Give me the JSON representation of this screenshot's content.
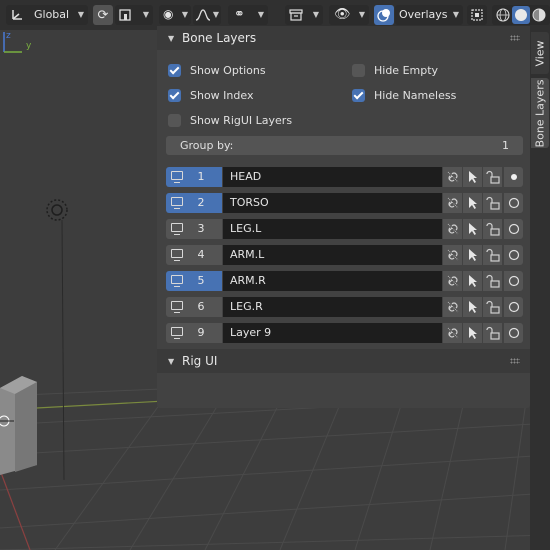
{
  "header": {
    "transform_orientation": "Global",
    "overlays_label": "Overlays"
  },
  "sidebar": {
    "tabs": [
      {
        "label": "View",
        "active": false
      },
      {
        "label": "Bone Layers",
        "active": true
      }
    ]
  },
  "bone_layers_panel": {
    "title": "Bone Layers",
    "options": {
      "show_options": {
        "label": "Show Options",
        "checked": true
      },
      "hide_empty": {
        "label": "Hide Empty",
        "checked": false
      },
      "show_index": {
        "label": "Show Index",
        "checked": true
      },
      "hide_nameless": {
        "label": "Hide Nameless",
        "checked": true
      },
      "show_rigui_layers": {
        "label": "Show RigUI Layers",
        "checked": false
      }
    },
    "group_by": {
      "label": "Group by:",
      "value": "1"
    },
    "layers": [
      {
        "index": "1",
        "name": "HEAD",
        "visible": true,
        "dot": true
      },
      {
        "index": "2",
        "name": "TORSO",
        "visible": true,
        "dot": false
      },
      {
        "index": "3",
        "name": "LEG.L",
        "visible": false,
        "dot": false
      },
      {
        "index": "4",
        "name": "ARM.L",
        "visible": false,
        "dot": false
      },
      {
        "index": "5",
        "name": "ARM.R",
        "visible": true,
        "dot": false
      },
      {
        "index": "6",
        "name": "LEG.R",
        "visible": false,
        "dot": false
      },
      {
        "index": "9",
        "name": "Layer 9",
        "visible": false,
        "dot": false
      }
    ]
  },
  "rig_ui_panel": {
    "title": "Rig UI"
  },
  "gizmo": {
    "y_axis_label": "y",
    "z_axis_label": "z"
  },
  "colors": {
    "accent": "#4772b3",
    "panel_bg": "#424242",
    "header_bg": "#303030",
    "viewport_bg": "#3d3d3d"
  }
}
